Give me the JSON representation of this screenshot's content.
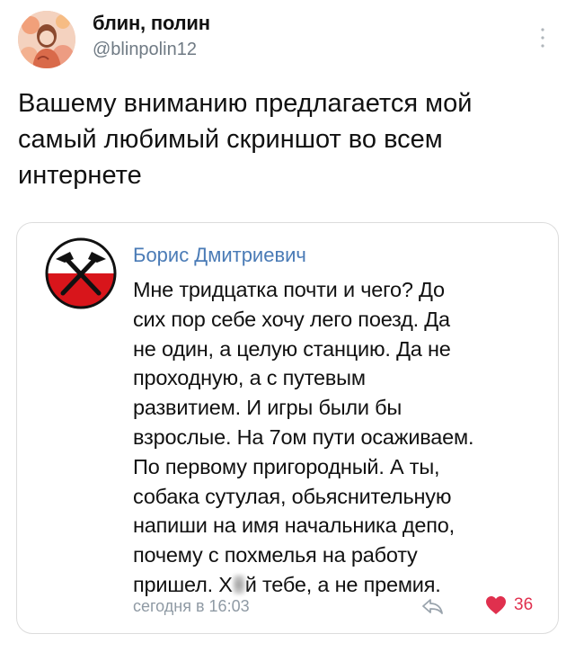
{
  "tweet": {
    "display_name": "блин, полин",
    "handle": "@blinpolin12",
    "text": "Вашему вниманию предлагается мой самый любимый скриншот во всем интернете"
  },
  "quoted_post": {
    "author": "Борис Дмитриевич",
    "lines": [
      "Мне тридцатка почти и чего? До",
      "сих пор себе хочу лего поезд. Да",
      "не один, а целую станцию. Да не",
      "проходную, а с путевым",
      "развитием. И игры были бы",
      "взрослые. На 7ом пути осаживаем.",
      "По первому пригородный. А ты,",
      "собака сутулая, обьяснительную",
      "напиши на имя начальника депо,",
      "почему с похмелья на работу"
    ],
    "last_line_start": "пришел. Х",
    "last_line_end": "й тебе, а не премия.",
    "timestamp": "сегодня в 16:03",
    "like_count": "36"
  },
  "icons": {
    "more": "more-vertical-icon",
    "reply": "reply-icon",
    "like": "heart-icon"
  },
  "colors": {
    "author_link": "#4a7bb6",
    "like": "#e0304e",
    "muted": "#8f9aa4",
    "badge_red": "#d8151b"
  }
}
